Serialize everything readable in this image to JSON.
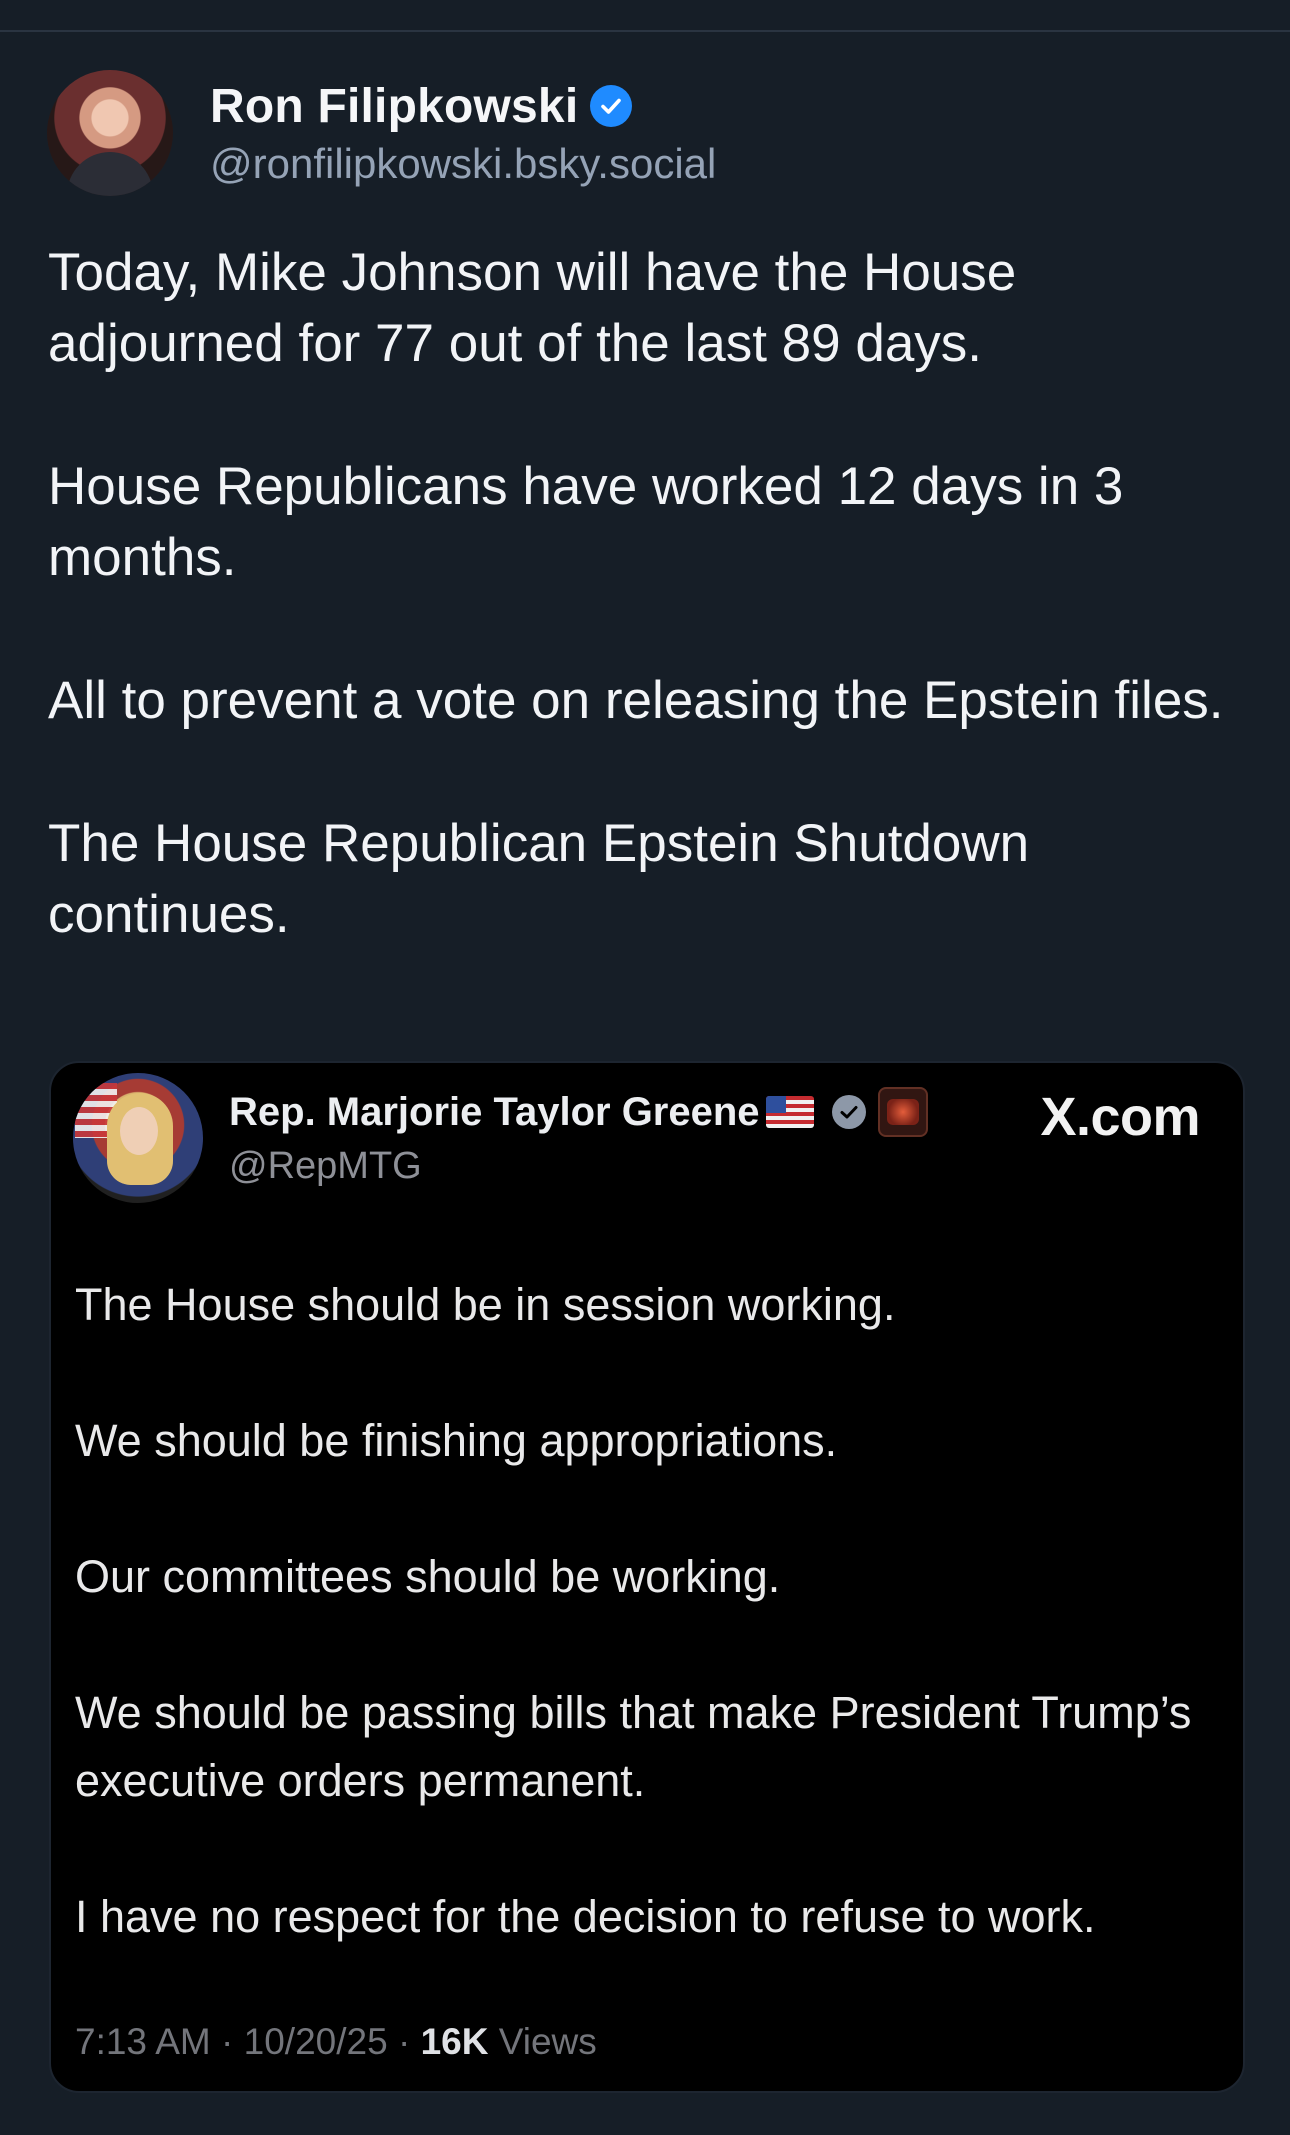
{
  "author": {
    "name": "Ron Filipkowski",
    "handle": "@ronfilipkowski.bsky.social"
  },
  "post": {
    "paragraphs": [
      "Today, Mike Johnson will have the House adjourned for 77 out of the last 89 days.",
      "House Republicans have worked 12 days in 3 months.",
      "All to prevent a vote on releasing the Epstein files.",
      "The House Republican Epstein Shutdown continues."
    ]
  },
  "embed": {
    "source": "X.com",
    "author": {
      "name": "Rep. Marjorie Taylor Greene",
      "handle": "@RepMTG",
      "flag_icon": "us-flag-icon",
      "check_icon": "gray-verified-icon",
      "badge_icon": "affiliation-badge-icon"
    },
    "paragraphs": [
      "The House should be in session working.",
      "We should be finishing appropriations.",
      "Our committees should be working.",
      "We should be passing bills that make President Trump’s executive orders permanent.",
      "I have no respect for the decision to refuse to work."
    ],
    "time": "7:13 AM",
    "date": "10/20/25",
    "views_count": "16K",
    "views_label": "Views",
    "separator": "·"
  },
  "colors": {
    "background": "#161e27",
    "embed_background": "#000000",
    "verified": "#1f8bff"
  }
}
